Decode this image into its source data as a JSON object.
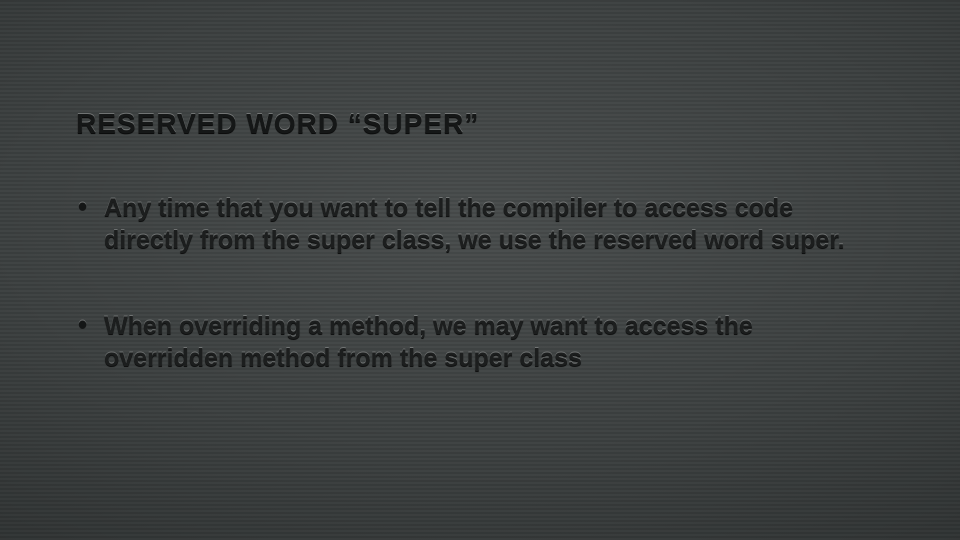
{
  "slide": {
    "title": "RESERVED WORD “SUPER”",
    "bullets": [
      "Any time that you want to tell the compiler to access code directly from the super class, we use the reserved word super.",
      "When overriding a method, we may want to access the overridden method from the super class"
    ]
  }
}
